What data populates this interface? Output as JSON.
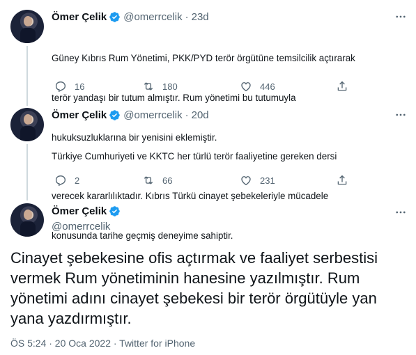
{
  "colors": {
    "accent": "#1d9bf0",
    "secondary_text": "#536471",
    "primary_text": "#0f1419"
  },
  "tweets": [
    {
      "name": "Ömer Çelik",
      "handle": "@omerrcelik",
      "separator": "·",
      "time": "23d",
      "text_lines": [
        "Güney Kıbrıs Rum Yönetimi, PKK/PYD terör örgütüne temsilcilik açtırarak",
        "terör yandaşı bir tutum almıştır. Rum yönetimi bu tutumuyla",
        "hukuksuzluklarına bir yenisini eklemiştir."
      ],
      "replies": "16",
      "retweets": "180",
      "likes": "446"
    },
    {
      "name": "Ömer Çelik",
      "handle": "@omerrcelik",
      "separator": "·",
      "time": "20d",
      "text_lines": [
        "Türkiye Cumhuriyeti ve KKTC her türlü terör faaliyetine gereken dersi",
        "verecek kararlılıktadır. Kıbrıs Türkü cinayet şebekeleriyle mücadele",
        "konusunda tarihe geçmiş deneyime sahiptir."
      ],
      "replies": "2",
      "retweets": "66",
      "likes": "231"
    }
  ],
  "main_tweet": {
    "name": "Ömer Çelik",
    "handle": "@omerrcelik",
    "text": "Cinayet şebekesine ofis açtırmak ve faaliyet serbestisi vermek Rum yönetiminin hanesine yazılmıştır. Rum yönetimi adını cinayet şebekesi bir terör örgütüyle yan yana yazdırmıştır.",
    "timestamp": "ÖS 5:24 · 20 Oca 2022 · Twitter for iPhone"
  },
  "icons": {
    "verified": "verified-badge-icon",
    "more": "more-icon",
    "reply": "reply-icon",
    "retweet": "retweet-icon",
    "like": "heart-icon",
    "share": "share-icon"
  }
}
